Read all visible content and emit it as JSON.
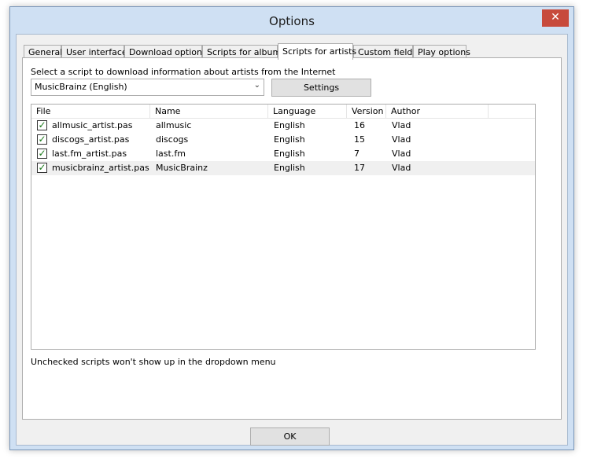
{
  "window": {
    "title": "Options",
    "close_symbol": "✕"
  },
  "tabs": [
    {
      "label": "General"
    },
    {
      "label": "User interface"
    },
    {
      "label": "Download options"
    },
    {
      "label": "Scripts for albums"
    },
    {
      "label": "Scripts for artists"
    },
    {
      "label": "Custom fields"
    },
    {
      "label": "Play options"
    }
  ],
  "active_tab": "Scripts for artists",
  "panel": {
    "instruction": "Select a script to download information about artists from the Internet",
    "dropdown_value": "MusicBrainz (English)",
    "settings_label": "Settings",
    "columns": [
      "File",
      "Name",
      "Language",
      "Version",
      "Author"
    ],
    "rows": [
      {
        "checked": true,
        "file": "allmusic_artist.pas",
        "name": "allmusic",
        "language": "English",
        "version": "16",
        "author": "Vlad"
      },
      {
        "checked": true,
        "file": "discogs_artist.pas",
        "name": "discogs",
        "language": "English",
        "version": "15",
        "author": "Vlad"
      },
      {
        "checked": true,
        "file": "last.fm_artist.pas",
        "name": "last.fm",
        "language": "English",
        "version": "7",
        "author": "Vlad"
      },
      {
        "checked": true,
        "file": "musicbrainz_artist.pas",
        "name": "MusicBrainz",
        "language": "English",
        "version": "17",
        "author": "Vlad"
      }
    ],
    "selected_row": 3,
    "note": "Unchecked scripts won't show up in the dropdown menu"
  },
  "footer": {
    "ok_label": "OK"
  },
  "icons": {
    "check": "✓",
    "dropdown": "⌄"
  },
  "colors": {
    "frame": "#cfe0f3",
    "close_button": "#c74a3c",
    "checkmark": "#1b7a1b"
  }
}
